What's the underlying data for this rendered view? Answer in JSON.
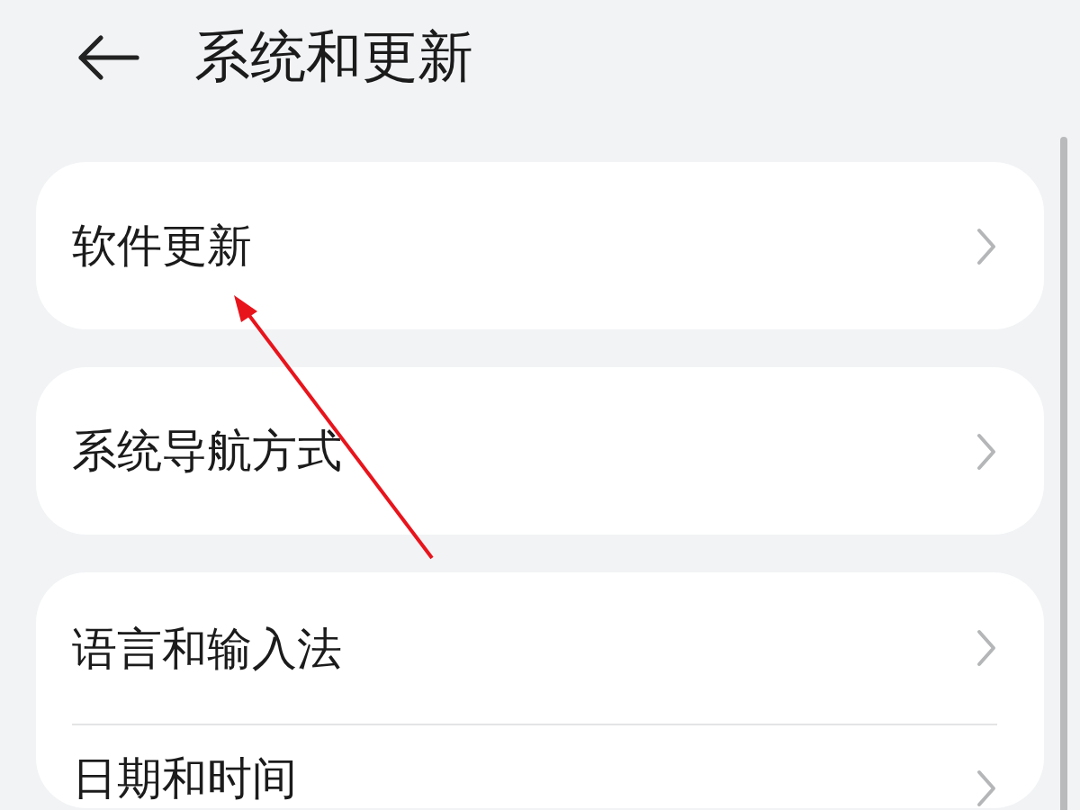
{
  "header": {
    "title": "系统和更新"
  },
  "groups": [
    {
      "items": [
        {
          "label": "软件更新"
        }
      ]
    },
    {
      "items": [
        {
          "label": "系统导航方式"
        }
      ]
    },
    {
      "items": [
        {
          "label": "语言和输入法"
        },
        {
          "label": "日期和时间"
        }
      ]
    }
  ]
}
